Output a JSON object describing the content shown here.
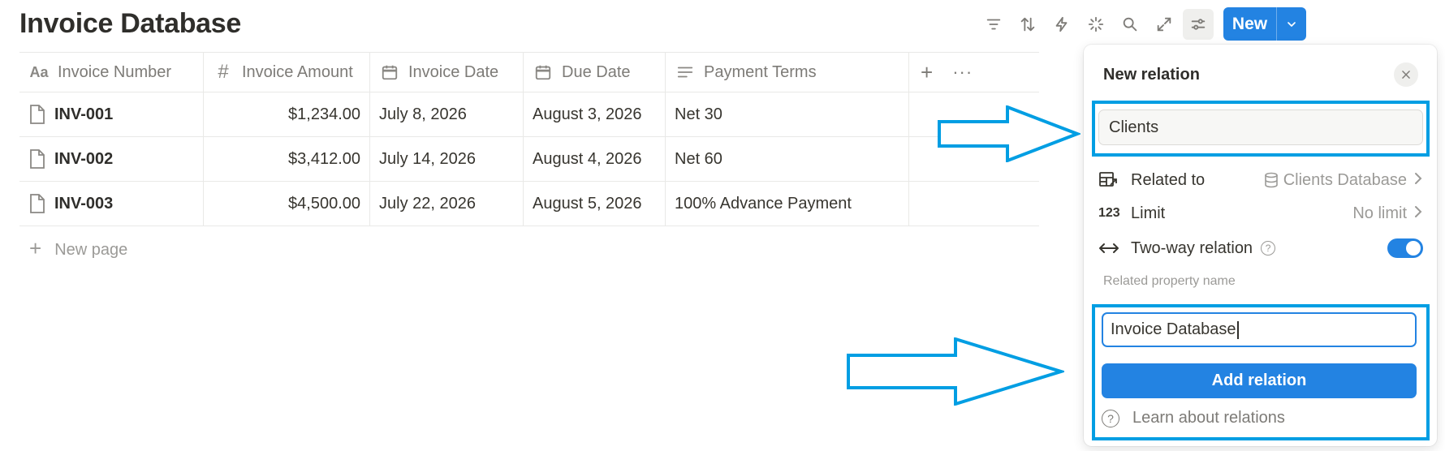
{
  "page": {
    "title": "Invoice Database"
  },
  "toolbar": {
    "icons": [
      "filter-icon",
      "sort-icon",
      "automation-icon",
      "ai-sparkle-icon",
      "search-icon",
      "expand-icon",
      "settings-sliders-icon"
    ],
    "new_label": "New"
  },
  "table": {
    "columns": [
      {
        "label": "Invoice Number",
        "icon": "title-aa-icon"
      },
      {
        "label": "Invoice Amount",
        "icon": "number-hash-icon"
      },
      {
        "label": "Invoice Date",
        "icon": "calendar-icon"
      },
      {
        "label": "Due Date",
        "icon": "calendar-icon"
      },
      {
        "label": "Payment Terms",
        "icon": "text-lines-icon"
      }
    ],
    "rows": [
      {
        "number": "INV-001",
        "amount": "$1,234.00",
        "date": "July 8, 2026",
        "due": "August 3, 2026",
        "terms": "Net 30"
      },
      {
        "number": "INV-002",
        "amount": "$3,412.00",
        "date": "July 14, 2026",
        "due": "August 4, 2026",
        "terms": "Net 60"
      },
      {
        "number": "INV-003",
        "amount": "$4,500.00",
        "date": "July 22, 2026",
        "due": "August 5, 2026",
        "terms": "100% Advance Payment"
      }
    ],
    "new_page_label": "New page"
  },
  "panel": {
    "title": "New relation",
    "name_value": "Clients",
    "related_to_label": "Related to",
    "related_to_value": "Clients Database",
    "limit_label": "Limit",
    "limit_value": "No limit",
    "two_way_label": "Two-way relation",
    "two_way_enabled": true,
    "related_property_label": "Related property name",
    "related_property_value": "Invoice Database",
    "add_button_label": "Add relation",
    "learn_label": "Learn about relations"
  },
  "annotations": {
    "highlight_color": "#009ee3"
  },
  "colors": {
    "accent": "#2383e2",
    "text": "#37352f",
    "muted": "#7d7b77"
  }
}
